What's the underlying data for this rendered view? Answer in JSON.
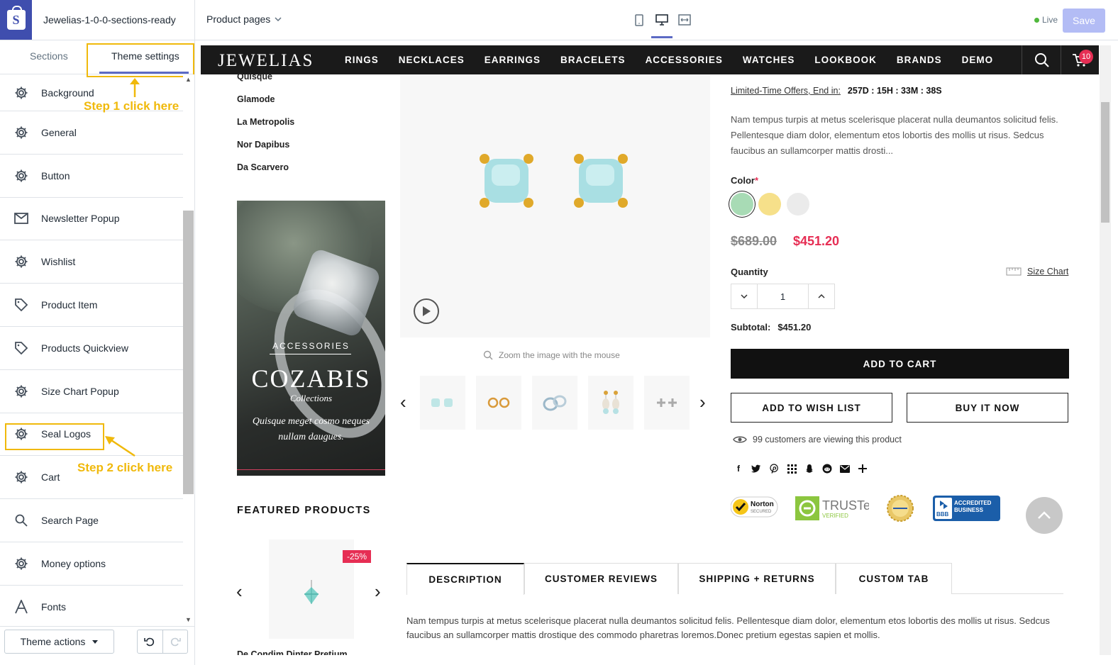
{
  "editor": {
    "theme_name": "Jewelias-1-0-0-sections-ready",
    "page_select": "Product pages",
    "live_label": "Live",
    "save_label": "Save"
  },
  "sidebar": {
    "tabs": [
      "Sections",
      "Theme settings"
    ],
    "items": [
      {
        "label": "Background",
        "icon": "gear-icon"
      },
      {
        "label": "General",
        "icon": "gear-icon"
      },
      {
        "label": "Button",
        "icon": "gear-icon"
      },
      {
        "label": "Newsletter Popup",
        "icon": "envelope-icon"
      },
      {
        "label": "Wishlist",
        "icon": "gear-icon"
      },
      {
        "label": "Product Item",
        "icon": "tag-icon"
      },
      {
        "label": "Products Quickview",
        "icon": "tag-icon"
      },
      {
        "label": "Size Chart Popup",
        "icon": "gear-icon"
      },
      {
        "label": "Seal Logos",
        "icon": "gear-icon"
      },
      {
        "label": "Cart",
        "icon": "gear-icon"
      },
      {
        "label": "Search Page",
        "icon": "search-icon"
      },
      {
        "label": "Money options",
        "icon": "gear-icon"
      },
      {
        "label": "Fonts",
        "icon": "font-icon"
      }
    ],
    "theme_actions": "Theme actions",
    "annotations": {
      "step1": "Step 1 click here",
      "step2": "Step 2 click here"
    },
    "annotation_color": "#f0b90b"
  },
  "store": {
    "logo": "JEWELIAS",
    "nav": [
      "RINGS",
      "NECKLACES",
      "EARRINGS",
      "BRACELETS",
      "ACCESSORIES",
      "WATCHES",
      "LOOKBOOK",
      "BRANDS",
      "DEMO"
    ],
    "cart_count": "10",
    "categories": [
      "Quisque",
      "Glamode",
      "La Metropolis",
      "Nor Dapibus",
      "Da Scarvero"
    ],
    "banner": {
      "kicker": "ACCESSORIES",
      "title": "COZABIS",
      "subtitle": "Collections",
      "text": "Quisque meget cosmo neques nullam daugues."
    },
    "featured": {
      "title": "FEATURED PRODUCTS",
      "discount": "-25%",
      "product_name": "De Condim Dinter Pretium"
    },
    "zoom_hint": "Zoom the image with the mouse",
    "product": {
      "offer_label": "Limited-Time Offers, End in:",
      "offer_timer": "257D : 15H : 33M : 38S",
      "description": "Nam tempus turpis at metus scelerisque placerat nulla deumantos solicitud felis. Pellentesque diam dolor, elementum etos lobortis des mollis ut risus. Sedcus faucibus an sullamcorper mattis drosti...",
      "color_label": "Color",
      "required_mark": "*",
      "swatches": [
        "#a8dbb5",
        "#f6e08a",
        "#ebebeb"
      ],
      "price_old": "$689.00",
      "price_new": "$451.20",
      "quantity_label": "Quantity",
      "size_chart": "Size Chart",
      "quantity": "1",
      "subtotal_label": "Subtotal:",
      "subtotal_value": "$451.20",
      "add_to_cart": "ADD TO CART",
      "wishlist": "ADD TO WISH LIST",
      "buy_now": "BUY IT NOW",
      "viewers": "99 customers are viewing this product"
    },
    "seals": {
      "norton": "Norton",
      "norton_sub": "SECURED",
      "truste": "TRUSTe",
      "truste_sub": "VERIFIED",
      "bbb": "ACCREDITED BUSINESS",
      "bbb_mark": "BBB"
    },
    "tabs": [
      "DESCRIPTION",
      "CUSTOMER REVIEWS",
      "SHIPPING + RETURNS",
      "CUSTOM TAB"
    ],
    "tab_content": "Nam tempus turpis at metus scelerisque placerat nulla deumantos solicitud felis. Pellentesque diam dolor, elementum etos lobortis des mollis ut risus. Sedcus faucibus an sullamcorper mattis drostique des commodo pharetras loremos.Donec pretium egestas sapien et mollis.",
    "accent": "#e62e54"
  }
}
